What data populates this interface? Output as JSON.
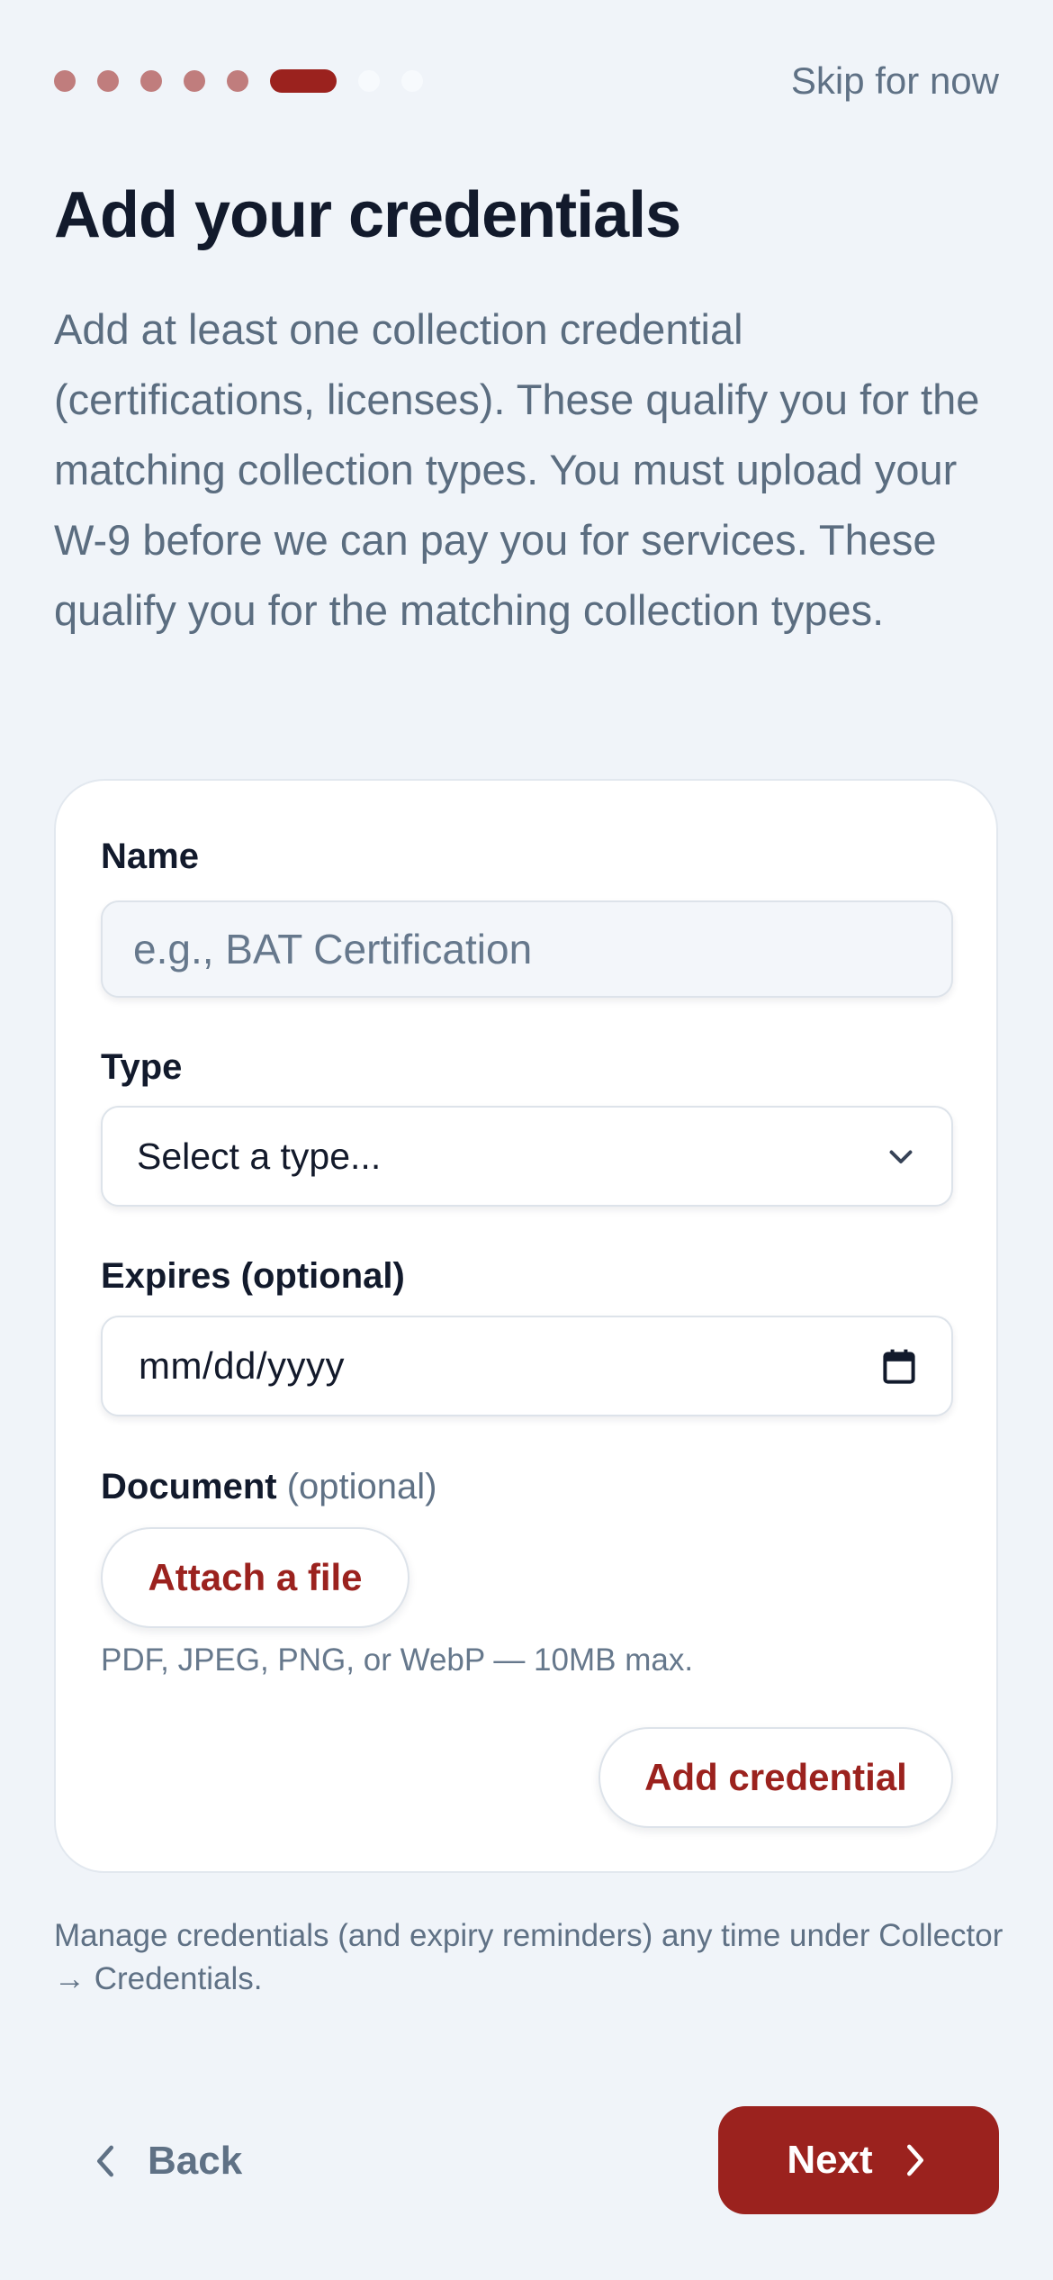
{
  "progress": {
    "total_steps": 8,
    "current_step": 6
  },
  "header": {
    "skip_label": "Skip for now"
  },
  "title": "Add your credentials",
  "intro": "Add at least one collection credential (certifications, licenses). These qualify you for the matching collection types. You must upload your W-9 before we can pay you for services. These qualify you for the matching collection types.",
  "form": {
    "name_label": "Name",
    "name_placeholder": "e.g., BAT Certification",
    "type_label": "Type",
    "type_value": "Select a type...",
    "expires_label": "Expires (optional)",
    "expires_placeholder": "mm/dd/yyyy",
    "document_label": "Document",
    "document_optional": "(optional)",
    "attach_label": "Attach a file",
    "file_hint": "PDF, JPEG, PNG, or WebP — 10MB max.",
    "add_label": "Add credential"
  },
  "footnote": "Manage credentials (and expiry reminders) any time under Collector → Credentials.",
  "nav": {
    "back_label": "Back",
    "next_label": "Next"
  },
  "colors": {
    "accent": "#9b221e",
    "background": "#f0f4f9",
    "muted_text": "#5f7185"
  },
  "icons": {
    "type_select": "chevron-down-icon",
    "expires": "calendar-icon",
    "back": "chevron-left-icon",
    "next": "chevron-right-icon"
  }
}
